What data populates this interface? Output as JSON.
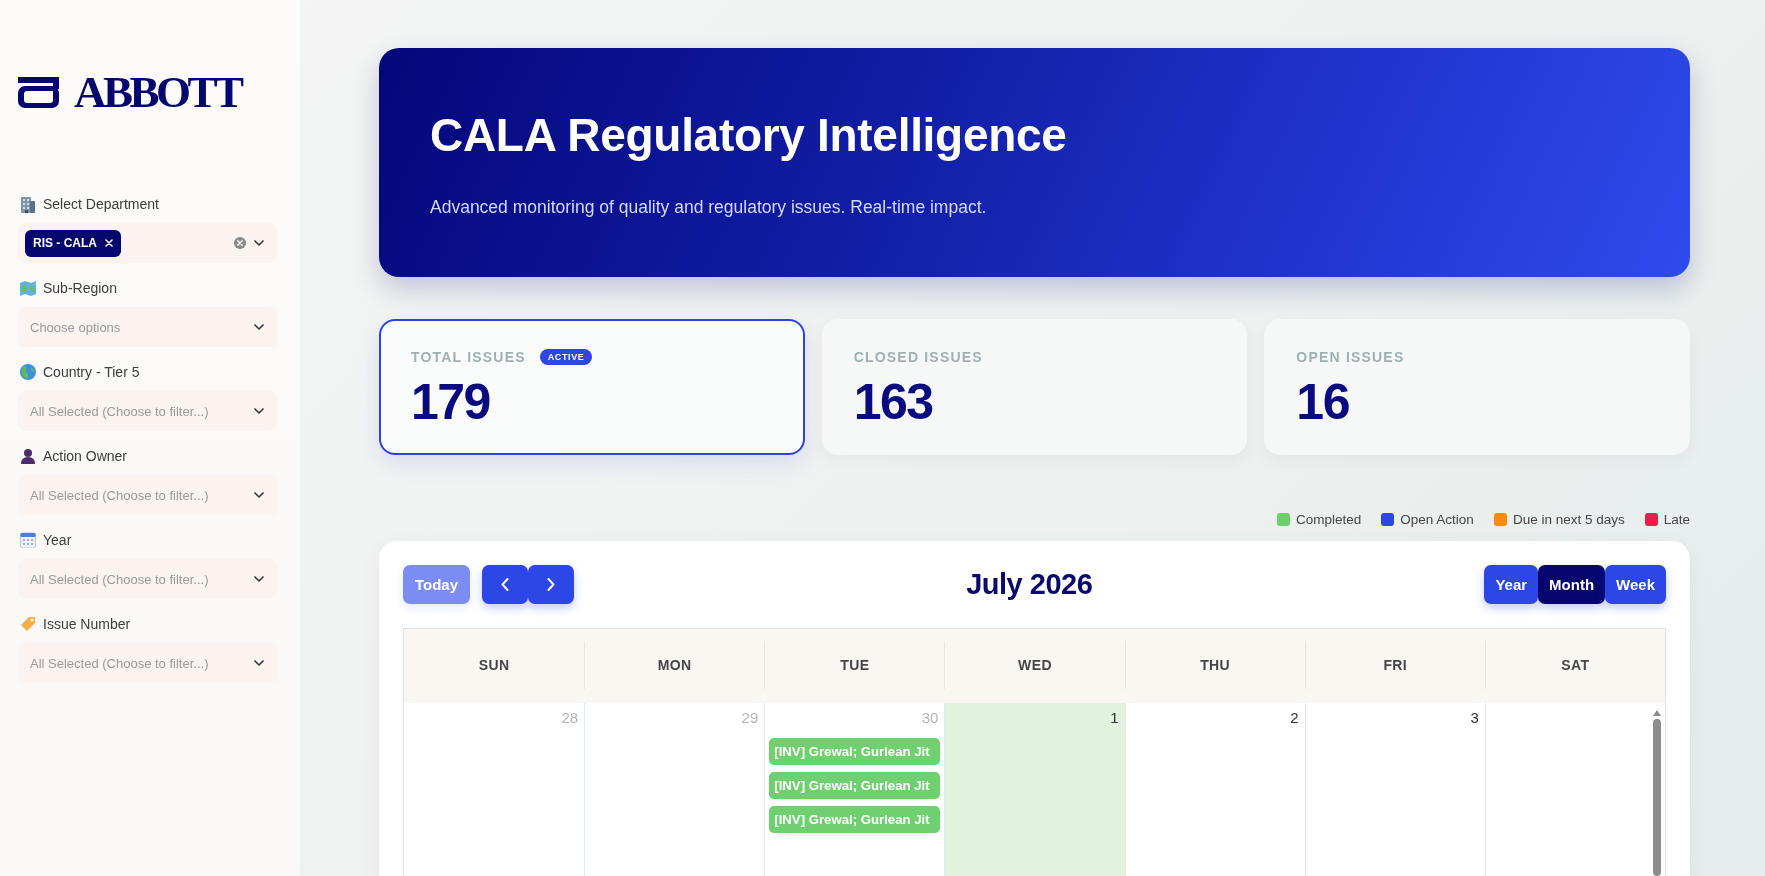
{
  "sidebar": {
    "logo": {
      "wordmark": "ABBOTT"
    },
    "filters": [
      {
        "label": "Select Department",
        "chips": [
          {
            "label": "RIS - CALA"
          }
        ]
      },
      {
        "label": "Sub-Region",
        "placeholder": "Choose options"
      },
      {
        "label": "Country - Tier 5",
        "placeholder": "All Selected (Choose to filter...)"
      },
      {
        "label": "Action Owner",
        "placeholder": "All Selected (Choose to filter...)"
      },
      {
        "label": "Year",
        "placeholder": "All Selected (Choose to filter...)"
      },
      {
        "label": "Issue Number",
        "placeholder": "All Selected (Choose to filter...)"
      }
    ]
  },
  "hero": {
    "title": "CALA Regulatory Intelligence",
    "subtitle": "Advanced monitoring of quality and regulatory issues. Real-time impact."
  },
  "stats": [
    {
      "label": "TOTAL ISSUES",
      "badge": "ACTIVE",
      "value": "179",
      "selected": true
    },
    {
      "label": "CLOSED ISSUES",
      "value": "163",
      "selected": false
    },
    {
      "label": "OPEN ISSUES",
      "value": "16",
      "selected": false
    }
  ],
  "legend": [
    {
      "label": "Completed",
      "color": "#6ccf6c"
    },
    {
      "label": "Open Action",
      "color": "#2d46e6"
    },
    {
      "label": "Due in next 5 days",
      "color": "#fb8c00"
    },
    {
      "label": "Late",
      "color": "#e91e4a"
    }
  ],
  "calendar": {
    "today_button": {
      "label": "Today",
      "disabled": true
    },
    "title": "July 2026",
    "views": [
      {
        "label": "Year",
        "selected": false
      },
      {
        "label": "Month",
        "selected": true
      },
      {
        "label": "Week",
        "selected": false
      }
    ],
    "weekdays": [
      "SUN",
      "MON",
      "TUE",
      "WED",
      "THU",
      "FRI",
      "SAT"
    ],
    "week": [
      {
        "day": "28",
        "other_month": true,
        "today": false
      },
      {
        "day": "29",
        "other_month": true,
        "today": false
      },
      {
        "day": "30",
        "other_month": true,
        "today": false,
        "events": [
          {
            "title": "[INV] Grewal; Gurlean Jit",
            "color": "#6fd06f"
          },
          {
            "title": "[INV] Grewal; Gurlean Jit",
            "color": "#6fd06f"
          },
          {
            "title": "[INV] Grewal; Gurlean Jit",
            "color": "#6fd06f"
          }
        ]
      },
      {
        "day": "1",
        "other_month": false,
        "today": true
      },
      {
        "day": "2",
        "other_month": false,
        "today": false
      },
      {
        "day": "3",
        "other_month": false,
        "today": false
      },
      {
        "today": false
      }
    ]
  }
}
